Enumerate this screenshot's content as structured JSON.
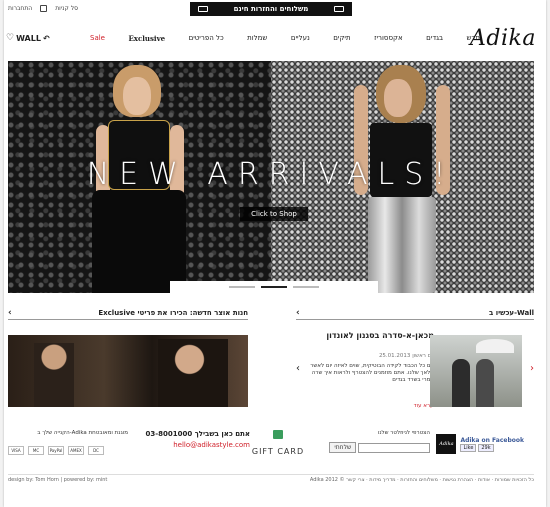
{
  "top": {
    "promo": "משלוחים והחזרות חינם",
    "links": [
      "התחברות",
      "סל קניות"
    ]
  },
  "nav": {
    "logo": "Adika",
    "wall": "WALL",
    "menu": [
      "Sale",
      "Exclusive",
      "כל הפריטים",
      "שמלות",
      "נעליים",
      "תיקים",
      "אקססוריז",
      "בגדים",
      "חדש"
    ]
  },
  "hero": {
    "title": "NEW ARRIVALS!",
    "button": "Click to Shop"
  },
  "sections": {
    "exclusive_heading": "Exclusive חנות אוצר חדשה: הכירו את פריטי",
    "wall_heading": "עכשיו ב-Wall"
  },
  "blog": {
    "title": "מכאן-א-סדרה בסגנון לאונדון",
    "date": "25.01.2013 יום ראשון",
    "body": "עם כל הכבוד לקידה הבוטיקית, שוים לאיזה יום לאשר מלאך שלנו. אתם מוזמנים להצטרף ולראות איך שרה זמרי בשרד בגדים.",
    "more": "קרא עוד"
  },
  "footer": {
    "payments_label": "הקנייה שלך ב-Adika מוגנת ומאובטחת",
    "payments": [
      "VISA",
      "MC",
      "PayPal",
      "AMEX",
      "DC"
    ],
    "phone": "03-8001000 אתם כאן בשבילך",
    "email": "hello@adikastyle.com",
    "gift": "GIFT CARD",
    "newsletter_label": "הצטרפי לניוזלטר שלנו",
    "newsletter_btn": "שלחתי",
    "fb_title": "Adika on Facebook",
    "fb_like": "Like",
    "fb_count": "29k"
  },
  "bottom": {
    "left": "design by: Tom Horn | powered by: mint",
    "right": "Adika 2012 © כל הזכויות שמורות · אודות · הצהרת נגישות · משלוחים והחזרות · מדריך מידות · צרי קשר"
  }
}
